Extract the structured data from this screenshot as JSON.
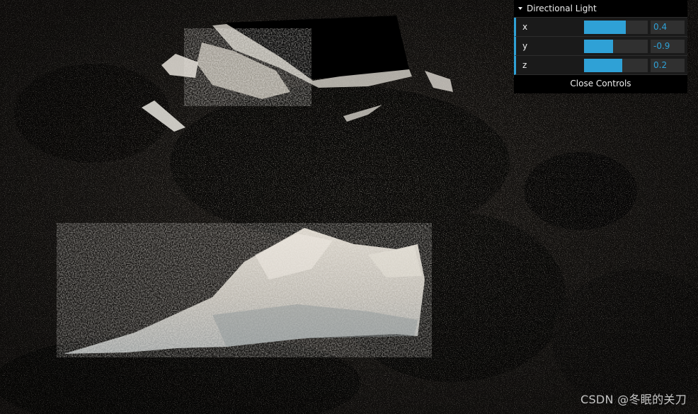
{
  "gui": {
    "folder_title": "Directional Light",
    "controls": [
      {
        "name": "x",
        "value": "0.4",
        "fraction": 0.65
      },
      {
        "name": "y",
        "value": "-0.9",
        "fraction": 0.45
      },
      {
        "name": "z",
        "value": "0.2",
        "fraction": 0.6
      }
    ],
    "close_label": "Close Controls",
    "accent_color": "#2fa1d6"
  },
  "watermark": "CSDN @冬眠的关刀"
}
